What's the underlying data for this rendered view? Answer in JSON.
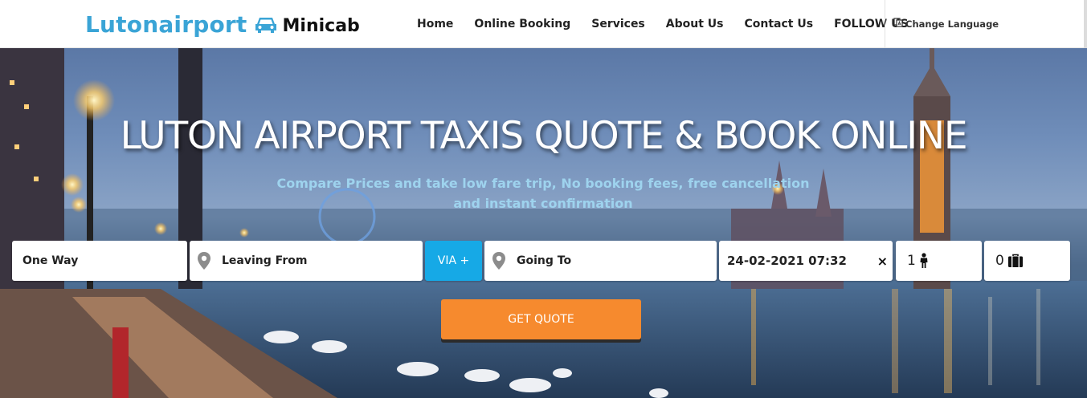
{
  "header": {
    "logo_main": "Lutonairport",
    "logo_sub": "Minicab",
    "nav": [
      "Home",
      "Online Booking",
      "Services",
      "About Us",
      "Contact Us",
      "FOLLOW US"
    ],
    "language_label": "Change Language"
  },
  "hero": {
    "title": "LUTON AIRPORT TAXIS QUOTE & BOOK ONLINE",
    "subtitle": "Compare Prices and take low fare trip, No booking fees, free cancellation and instant confirmation"
  },
  "form": {
    "trip_type": "One Way",
    "leaving_from": "Leaving From",
    "via_label": "VIA +",
    "going_to": "Going To",
    "datetime": "24-02-2021 07:32",
    "clear_symbol": "×",
    "passengers": "1",
    "luggage": "0",
    "quote_label": "GET QUOTE"
  },
  "colors": {
    "brand": "#3aa4d6",
    "via": "#16a9e6",
    "quote": "#f68a2e",
    "subtitle": "#9ed3ee"
  },
  "icons": [
    "car-icon",
    "language-icon",
    "map-pin-icon",
    "person-icon",
    "suitcase-icon"
  ]
}
